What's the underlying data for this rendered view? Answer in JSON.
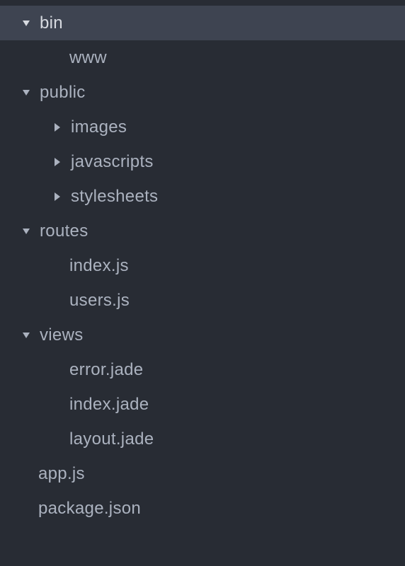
{
  "tree": {
    "items": [
      {
        "label": "bin",
        "level": 0,
        "expanded": true,
        "hasArrow": true,
        "selected": true
      },
      {
        "label": "www",
        "level": 1,
        "expanded": null,
        "hasArrow": false,
        "selected": false
      },
      {
        "label": "public",
        "level": 0,
        "expanded": true,
        "hasArrow": true,
        "selected": false
      },
      {
        "label": "images",
        "level": 1,
        "expanded": false,
        "hasArrow": true,
        "selected": false
      },
      {
        "label": "javascripts",
        "level": 1,
        "expanded": false,
        "hasArrow": true,
        "selected": false
      },
      {
        "label": "stylesheets",
        "level": 1,
        "expanded": false,
        "hasArrow": true,
        "selected": false
      },
      {
        "label": "routes",
        "level": 0,
        "expanded": true,
        "hasArrow": true,
        "selected": false
      },
      {
        "label": "index.js",
        "level": 1,
        "expanded": null,
        "hasArrow": false,
        "selected": false
      },
      {
        "label": "users.js",
        "level": 1,
        "expanded": null,
        "hasArrow": false,
        "selected": false
      },
      {
        "label": "views",
        "level": 0,
        "expanded": true,
        "hasArrow": true,
        "selected": false
      },
      {
        "label": "error.jade",
        "level": 1,
        "expanded": null,
        "hasArrow": false,
        "selected": false
      },
      {
        "label": "index.jade",
        "level": 1,
        "expanded": null,
        "hasArrow": false,
        "selected": false
      },
      {
        "label": "layout.jade",
        "level": 1,
        "expanded": null,
        "hasArrow": false,
        "selected": false
      },
      {
        "label": "app.js",
        "level": 0,
        "expanded": null,
        "hasArrow": false,
        "selected": false
      },
      {
        "label": "package.json",
        "level": 0,
        "expanded": null,
        "hasArrow": false,
        "selected": false
      }
    ]
  }
}
